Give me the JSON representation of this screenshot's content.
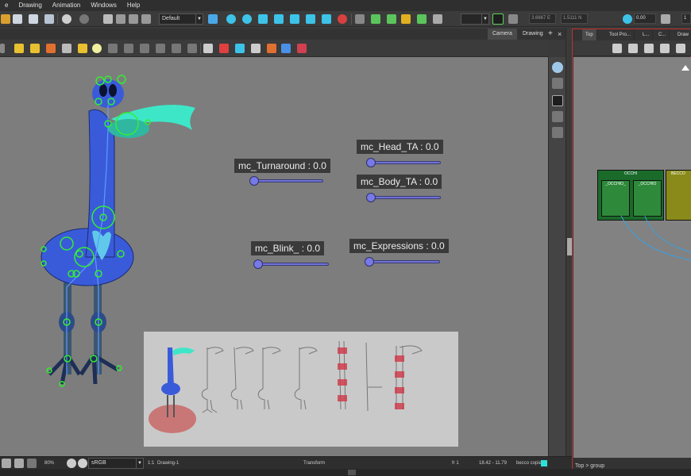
{
  "menu": [
    "e",
    "Drawing",
    "Animation",
    "Windows",
    "Help"
  ],
  "toolbar": {
    "palette_combo": "Default",
    "field_x": "3.6667 E",
    "field_y": "1.5111 N",
    "field_angle": "0.00",
    "field_scale": "1"
  },
  "view_tabs": {
    "camera": "Camera",
    "drawing": "Drawing",
    "add": "+",
    "close": "×"
  },
  "sliders": [
    {
      "name": "turnaround",
      "label": "mc_Turnaround : 0.0"
    },
    {
      "name": "head-ta",
      "label": "mc_Head_TA : 0.0"
    },
    {
      "name": "body-ta",
      "label": "mc_Body_TA : 0.0"
    },
    {
      "name": "blink",
      "label": "mc_Blink_ : 0.0"
    },
    {
      "name": "expressions",
      "label": "mc_Expressions : 0.0"
    }
  ],
  "right_panel": {
    "tabs": [
      "Top",
      "Tool Pro...",
      "L...",
      "C...",
      "Draw"
    ],
    "nodes": {
      "occhi": "OCCHI",
      "occhio_1": "_OCCHIO_",
      "occhio_2": "_OCCHIO",
      "becco": "BECCO"
    },
    "breadcrumb": "Top > group"
  },
  "status": {
    "zoom": "80%",
    "color_space": "sRGB",
    "frame_ratio": "1:1",
    "drawing": "Drawing-1",
    "tool": "Transform",
    "frame": "fr 1",
    "coords": "18.42 - 11.79",
    "layer": "becco copia"
  },
  "colors": {
    "canvas": "#7d7d7d",
    "bird_body": "#3a5bd9",
    "beak": "#3ee6c8",
    "rig_points": "#33ee33",
    "slider": "#6f72d8",
    "panel_border": "#c03030"
  }
}
